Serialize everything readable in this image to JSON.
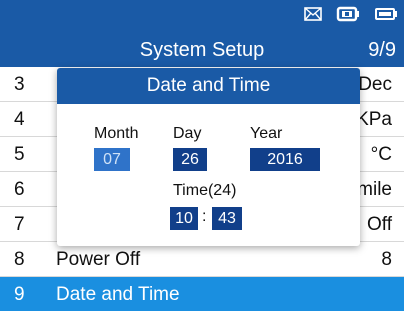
{
  "colors": {
    "header": "#1a5aa6",
    "selected_row": "#1a8fe0",
    "field_bg": "#113f8a",
    "field_focus_bg": "#2f73c9"
  },
  "status_icons": [
    "mail-icon",
    "battery-charge-icon",
    "battery-icon"
  ],
  "title_bar": {
    "title": "System Setup",
    "page": "9/9"
  },
  "menu": {
    "rows": [
      {
        "num": "3",
        "label": "",
        "value": "Dec"
      },
      {
        "num": "4",
        "label": "",
        "value": "KPa"
      },
      {
        "num": "5",
        "label": "",
        "value": "°C"
      },
      {
        "num": "6",
        "label": "",
        "value": "mile"
      },
      {
        "num": "7",
        "label": "",
        "value": "Off"
      },
      {
        "num": "8",
        "label": "Power Off",
        "value": "8"
      },
      {
        "num": "9",
        "label": "Date and Time",
        "value": ""
      }
    ]
  },
  "dialog": {
    "title": "Date and Time",
    "month_label": "Month",
    "month": "07",
    "day_label": "Day",
    "day": "26",
    "year_label": "Year",
    "year": "2016",
    "time_label": "Time(24)",
    "hour": "10",
    "colon": ":",
    "minute": "43"
  }
}
